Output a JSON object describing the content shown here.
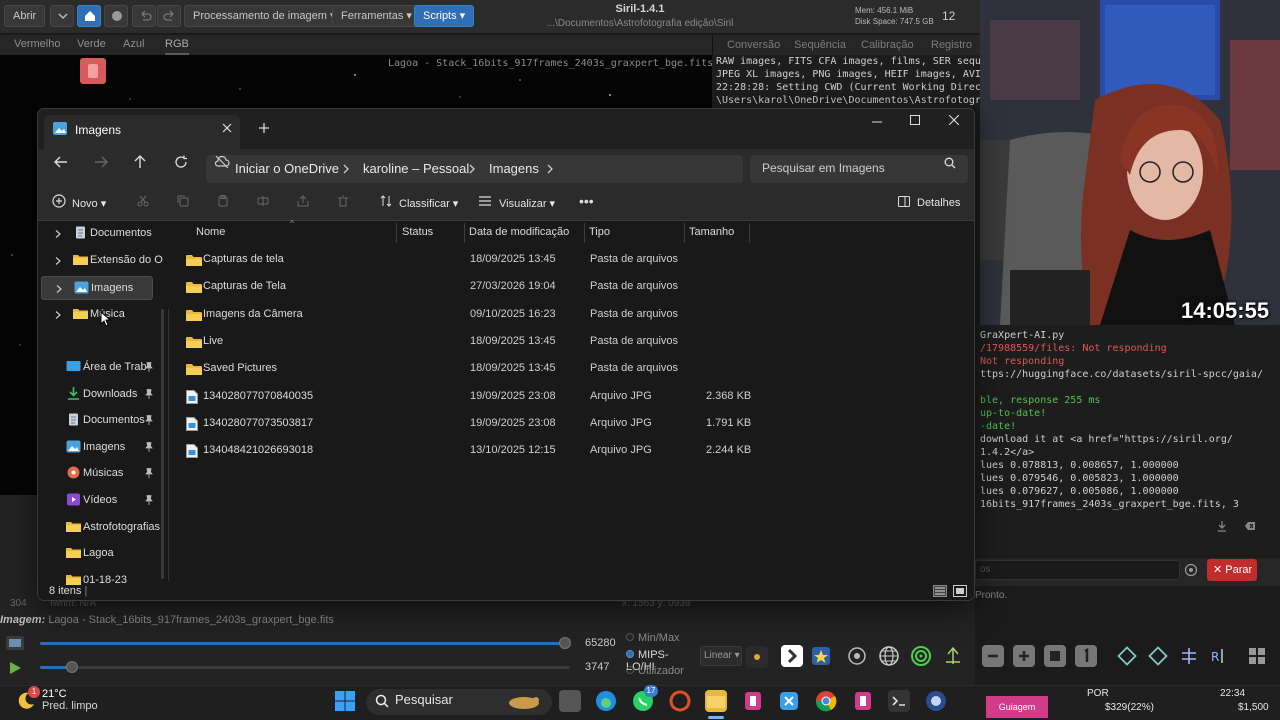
{
  "siril": {
    "toolbar": {
      "open_label": "Abrir",
      "processing_menu": "Processamento de imagem",
      "tools_menu": "Ferramentas",
      "scripts_menu": "Scripts"
    },
    "title": "Siril-1.4.1",
    "path": "...\\Documentos\\Astrofotografia edição\\Siril",
    "mem": "Mem: 456.1 MiB",
    "disk": "Disk Space: 747.5 GB",
    "threads": "12",
    "channel_tabs": [
      "Vermelho",
      "Verde",
      "Azul",
      "RGB"
    ],
    "log_tabs": [
      "Conversão",
      "Sequência",
      "Calibração",
      "Registro"
    ],
    "image_filename": "Lagoa - Stack_16bits_917frames_2403s_graxpert_bge.fits",
    "log_top": [
      "RAW images, FITS CFA images, films, SER sequ",
      "JPEG XL images, PNG images, HEIF images, AVI",
      "22:28:28: Setting CWD (Current Working Direc",
      "\\Users\\karol\\OneDrive\\Documentos\\Astrofotogr"
    ],
    "log_right": [
      {
        "text": "GraXpert-AI.py",
        "color": "w"
      },
      {
        "text": "/17988559/files: Not responding",
        "color": "r"
      },
      {
        "text": "Not responding",
        "color": "r"
      },
      {
        "text": "ttps://huggingface.co/datasets/siril-spcc/gaia/",
        "color": "w"
      },
      {
        "text": "",
        "color": "w"
      },
      {
        "text": "ble, response 255 ms",
        "color": "g"
      },
      {
        "text": " up-to-date!",
        "color": "g"
      },
      {
        "text": "-date!",
        "color": "g"
      },
      {
        "text": " download it at <a href=\"https://siril.org/",
        "color": "w"
      },
      {
        "text": "1.4.2</a>",
        "color": "w"
      },
      {
        "text": "lues 0.078813, 0.008657, 1.000000",
        "color": "w"
      },
      {
        "text": "lues 0.079546, 0.005823, 1.000000",
        "color": "w"
      },
      {
        "text": "lues 0.079627, 0.005086, 1.000000",
        "color": "w"
      },
      {
        "text": "16bits_917frames_2403s_graxpert_bge.fits, 3",
        "color": "w"
      }
    ],
    "stop_label": "Parar",
    "status_label": "Pronto.",
    "image_caption_label": "Imagem:",
    "image_caption_value": "Lagoa - Stack_16bits_917frames_2403s_graxpert_bge.fits",
    "slider_max_value": "65280",
    "slider_min_value": "3747",
    "slider_max_fraction": 0.99,
    "slider_min_fraction": 0.06,
    "radio_options": [
      "Min/Max",
      "MIPS-LO/HI",
      "Utilizador"
    ],
    "radio_selected": "MIPS-LO/HI",
    "scale_mode": "Linear",
    "coord_readout": "x: 1563 y: 0939",
    "left_readout": "304",
    "frame_readout": "fwhm: N/A"
  },
  "webcam": {
    "clock": "14:05:55"
  },
  "explorer": {
    "tab_title": "Imagens",
    "breadcrumbs": [
      "Iniciar o OneDrive",
      "karoline – Pessoal",
      "Imagens"
    ],
    "search_placeholder": "Pesquisar em Imagens",
    "commands": {
      "new": "Novo",
      "sort": "Classificar",
      "view": "Visualizar",
      "details": "Detalhes"
    },
    "nav_tree": [
      {
        "label": "Documentos",
        "icon": "document-icon",
        "selected": false
      },
      {
        "label": "Extensão do O",
        "icon": "folder-icon",
        "selected": false
      },
      {
        "label": "Imagens",
        "icon": "pictures-icon",
        "selected": true
      },
      {
        "label": "Música",
        "icon": "folder-icon",
        "selected": false
      }
    ],
    "nav_quick": [
      {
        "label": "Área de Trab",
        "icon": "desktop-icon",
        "pinned": true
      },
      {
        "label": "Downloads",
        "icon": "download-icon",
        "pinned": true
      },
      {
        "label": "Documentos",
        "icon": "document-icon",
        "pinned": true
      },
      {
        "label": "Imagens",
        "icon": "pictures-icon",
        "pinned": true
      },
      {
        "label": "Músicas",
        "icon": "music-icon",
        "pinned": true
      },
      {
        "label": "Vídeos",
        "icon": "video-icon",
        "pinned": true
      },
      {
        "label": "Astrofotografias",
        "icon": "folder-icon",
        "pinned": false
      },
      {
        "label": "Lagoa",
        "icon": "folder-icon",
        "pinned": false
      },
      {
        "label": "01-18-23",
        "icon": "folder-icon",
        "pinned": false
      }
    ],
    "columns": [
      "Nome",
      "Status",
      "Data de modificação",
      "Tipo",
      "Tamanho"
    ],
    "files": [
      {
        "name": "Capturas de tela",
        "status": "",
        "date": "18/09/2025 13:45",
        "type": "Pasta de arquivos",
        "size": "",
        "kind": "folder"
      },
      {
        "name": "Capturas de Tela",
        "status": "",
        "date": "27/03/2026 19:04",
        "type": "Pasta de arquivos",
        "size": "",
        "kind": "folder"
      },
      {
        "name": "Imagens da Câmera",
        "status": "",
        "date": "09/10/2025 16:23",
        "type": "Pasta de arquivos",
        "size": "",
        "kind": "folder"
      },
      {
        "name": "Live",
        "status": "",
        "date": "18/09/2025 13:45",
        "type": "Pasta de arquivos",
        "size": "",
        "kind": "folder"
      },
      {
        "name": "Saved Pictures",
        "status": "",
        "date": "18/09/2025 13:45",
        "type": "Pasta de arquivos",
        "size": "",
        "kind": "folder"
      },
      {
        "name": "134028077070840035",
        "status": "",
        "date": "19/09/2025 23:08",
        "type": "Arquivo JPG",
        "size": "2.368 KB",
        "kind": "file"
      },
      {
        "name": "134028077073503817",
        "status": "",
        "date": "19/09/2025 23:08",
        "type": "Arquivo JPG",
        "size": "1.791 KB",
        "kind": "file"
      },
      {
        "name": "134048421026693018",
        "status": "",
        "date": "13/10/2025 12:15",
        "type": "Arquivo JPG",
        "size": "2.244 KB",
        "kind": "file"
      }
    ],
    "status_count": "8 itens"
  },
  "taskbar": {
    "weather_temp": "21°C",
    "weather_desc": "Pred. limpo",
    "weather_badge": "1",
    "search_label": "Pesquisar",
    "whatsapp_badge": "17",
    "guiagem_label": "Guiagem telescópio",
    "ticker_price": "$329(22%)",
    "ticker_price2": "$1,500",
    "lang": "POR",
    "time": "22:34"
  },
  "colors": {
    "accent_blue": "#2f6fb5",
    "stop_red": "#c12d2d",
    "log_green": "#4ec24e",
    "log_red": "#e05757",
    "folder_yellow": "#e8b93a"
  }
}
